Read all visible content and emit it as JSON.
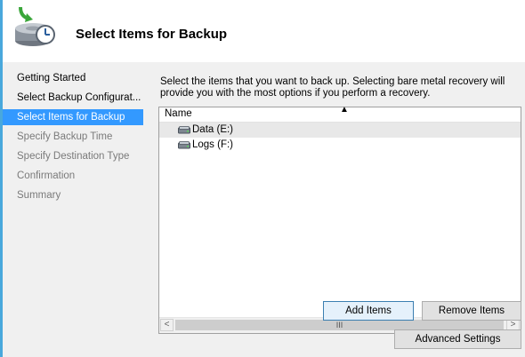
{
  "header": {
    "title": "Select Items for Backup",
    "icon": "backup-wizard-icon"
  },
  "sidebar": {
    "items": [
      {
        "label": "Getting Started",
        "state": "normal"
      },
      {
        "label": "Select Backup Configurat...",
        "state": "normal"
      },
      {
        "label": "Select Items for Backup",
        "state": "selected"
      },
      {
        "label": "Specify Backup Time",
        "state": "disabled"
      },
      {
        "label": "Specify Destination Type",
        "state": "disabled"
      },
      {
        "label": "Confirmation",
        "state": "disabled"
      },
      {
        "label": "Summary",
        "state": "disabled"
      }
    ]
  },
  "main": {
    "description": "Select the items that you want to back up. Selecting bare metal recovery will provide you with the most options if you perform a recovery.",
    "tree": {
      "column_header": "Name",
      "sort_indicator": "▲",
      "items": [
        {
          "label": "Data (E:)",
          "icon": "drive-icon"
        },
        {
          "label": "Logs (F:)",
          "icon": "drive-icon"
        }
      ],
      "scroll_left": "<",
      "scroll_right": ">",
      "scroll_thumb_grip": "III"
    },
    "buttons": {
      "add_items": "Add Items",
      "remove_items": "Remove Items",
      "advanced_settings": "Advanced Settings"
    }
  },
  "colors": {
    "accent_blue": "#3399ff",
    "window_border": "#49a8dc",
    "panel_bg": "#f0f0f0"
  }
}
